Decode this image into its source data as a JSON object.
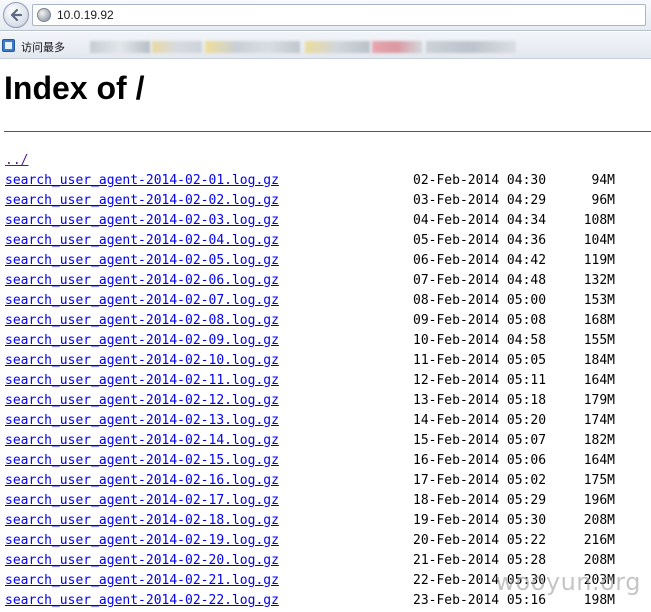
{
  "browser": {
    "url": "10.0.19.92",
    "bookmarks_label": "访问最多"
  },
  "page": {
    "title": "Index of /",
    "parent_link": "../"
  },
  "files": [
    {
      "name": "search_user_agent-2014-02-01.log.gz",
      "date": "02-Feb-2014 04:30",
      "size": "94M"
    },
    {
      "name": "search_user_agent-2014-02-02.log.gz",
      "date": "03-Feb-2014 04:29",
      "size": "96M"
    },
    {
      "name": "search_user_agent-2014-02-03.log.gz",
      "date": "04-Feb-2014 04:34",
      "size": "108M"
    },
    {
      "name": "search_user_agent-2014-02-04.log.gz",
      "date": "05-Feb-2014 04:36",
      "size": "104M"
    },
    {
      "name": "search_user_agent-2014-02-05.log.gz",
      "date": "06-Feb-2014 04:42",
      "size": "119M"
    },
    {
      "name": "search_user_agent-2014-02-06.log.gz",
      "date": "07-Feb-2014 04:48",
      "size": "132M"
    },
    {
      "name": "search_user_agent-2014-02-07.log.gz",
      "date": "08-Feb-2014 05:00",
      "size": "153M"
    },
    {
      "name": "search_user_agent-2014-02-08.log.gz",
      "date": "09-Feb-2014 05:08",
      "size": "168M"
    },
    {
      "name": "search_user_agent-2014-02-09.log.gz",
      "date": "10-Feb-2014 04:58",
      "size": "155M"
    },
    {
      "name": "search_user_agent-2014-02-10.log.gz",
      "date": "11-Feb-2014 05:05",
      "size": "184M"
    },
    {
      "name": "search_user_agent-2014-02-11.log.gz",
      "date": "12-Feb-2014 05:11",
      "size": "164M"
    },
    {
      "name": "search_user_agent-2014-02-12.log.gz",
      "date": "13-Feb-2014 05:18",
      "size": "179M"
    },
    {
      "name": "search_user_agent-2014-02-13.log.gz",
      "date": "14-Feb-2014 05:20",
      "size": "174M"
    },
    {
      "name": "search_user_agent-2014-02-14.log.gz",
      "date": "15-Feb-2014 05:07",
      "size": "182M"
    },
    {
      "name": "search_user_agent-2014-02-15.log.gz",
      "date": "16-Feb-2014 05:06",
      "size": "164M"
    },
    {
      "name": "search_user_agent-2014-02-16.log.gz",
      "date": "17-Feb-2014 05:02",
      "size": "175M"
    },
    {
      "name": "search_user_agent-2014-02-17.log.gz",
      "date": "18-Feb-2014 05:29",
      "size": "196M"
    },
    {
      "name": "search_user_agent-2014-02-18.log.gz",
      "date": "19-Feb-2014 05:30",
      "size": "208M"
    },
    {
      "name": "search_user_agent-2014-02-19.log.gz",
      "date": "20-Feb-2014 05:22",
      "size": "216M"
    },
    {
      "name": "search_user_agent-2014-02-20.log.gz",
      "date": "21-Feb-2014 05:28",
      "size": "208M"
    },
    {
      "name": "search_user_agent-2014-02-21.log.gz",
      "date": "22-Feb-2014 05:30",
      "size": "203M"
    },
    {
      "name": "search_user_agent-2014-02-22.log.gz",
      "date": "23-Feb-2014 05:16",
      "size": "198M"
    }
  ],
  "watermark": "wooyun.org"
}
